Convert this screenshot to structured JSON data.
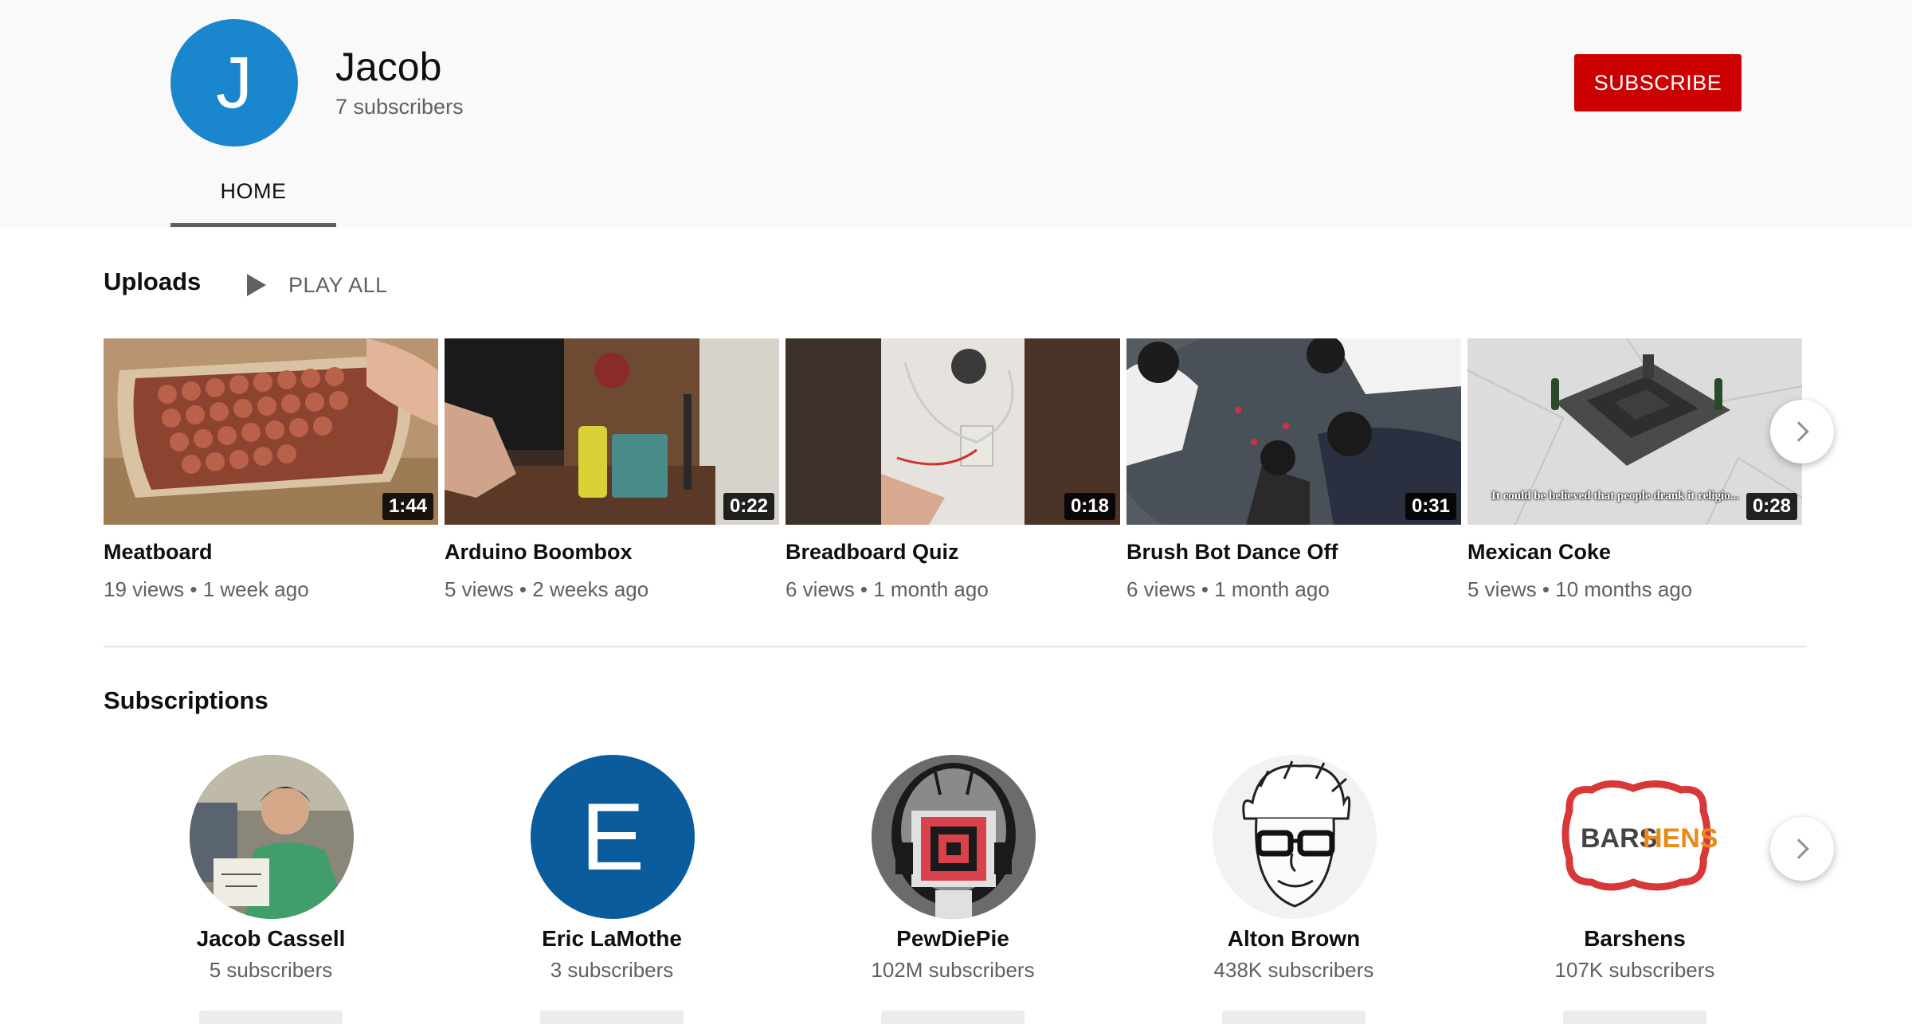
{
  "channel": {
    "avatar_letter": "J",
    "avatar_color": "#1a86cd",
    "name": "Jacob",
    "subscribers": "7 subscribers",
    "subscribe_label": "SUBSCRIBE",
    "subscribe_color": "#cc0000"
  },
  "tabs": [
    {
      "label": "HOME",
      "selected": true
    }
  ],
  "uploads": {
    "title": "Uploads",
    "play_all_label": "PLAY ALL",
    "videos": [
      {
        "title": "Meatboard",
        "duration": "1:44",
        "meta": "19 views • 1 week ago"
      },
      {
        "title": "Arduino Boombox",
        "duration": "0:22",
        "meta": "5 views • 2 weeks ago"
      },
      {
        "title": "Breadboard Quiz",
        "duration": "0:18",
        "meta": "6 views • 1 month ago"
      },
      {
        "title": "Brush Bot Dance Off",
        "duration": "0:31",
        "meta": "6 views • 1 month ago"
      },
      {
        "title": "Mexican Coke",
        "duration": "0:28",
        "meta": "5 views • 10 months ago",
        "caption": "It could be believed that people drank it religio..."
      }
    ]
  },
  "subscriptions": {
    "title": "Subscriptions",
    "channels": [
      {
        "name": "Jacob Cassell",
        "subscribers": "5 subscribers"
      },
      {
        "name": "Eric LaMothe",
        "subscribers": "3 subscribers",
        "avatar_letter": "E",
        "avatar_color": "#0b5c9c"
      },
      {
        "name": "PewDiePie",
        "subscribers": "102M subscribers"
      },
      {
        "name": "Alton Brown",
        "subscribers": "438K subscribers"
      },
      {
        "name": "Barshens",
        "subscribers": "107K subscribers",
        "logo_text_a": "BARS",
        "logo_text_b": "HENS"
      }
    ]
  },
  "icons": [
    "play-icon",
    "chevron-right-icon"
  ]
}
